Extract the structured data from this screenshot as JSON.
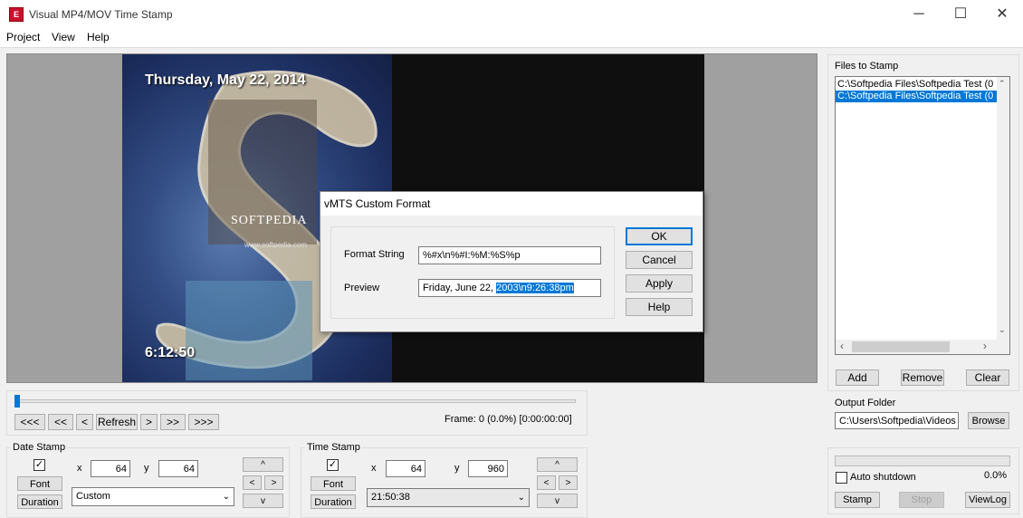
{
  "window": {
    "title": "Visual MP4/MOV Time Stamp",
    "icon": "app-logo-icon",
    "minimize": "─",
    "maximize": "☐",
    "close": "✕"
  },
  "menu": [
    "Project",
    "View",
    "Help"
  ],
  "video": {
    "date_overlay": "Thursday, May 22, 2014",
    "time_overlay": "6:12:50",
    "watermark": "SOFTPEDIA",
    "watermark_url": "www.softpedia.com"
  },
  "dialog": {
    "title": "vMTS Custom Format",
    "format_label": "Format String",
    "format_value": "%#x\\n%#I:%M:%S%p",
    "preview_label": "Preview",
    "preview_plain": "Friday, June 22, ",
    "preview_selected": "2003\\n9:26:38pm",
    "buttons": {
      "ok": "OK",
      "cancel": "Cancel",
      "apply": "Apply",
      "help": "Help"
    }
  },
  "files": {
    "label": "Files to Stamp",
    "items": [
      "C:\\Softpedia Files\\Softpedia Test (0",
      "C:\\Softpedia Files\\Softpedia Test (0"
    ],
    "selected_index": 1,
    "add": "Add",
    "remove": "Remove",
    "clear": "Clear"
  },
  "output": {
    "label": "Output Folder",
    "value": "C:\\Users\\Softpedia\\Videos",
    "browse": "Browse"
  },
  "playback": {
    "position": 0.0,
    "nav": [
      "<<<",
      "<<",
      "<",
      "Refresh",
      ">",
      ">>",
      ">>>"
    ],
    "frame_text": "Frame: 0 (0.0%) [0:00:00:00]"
  },
  "date_stamp": {
    "label": "Date Stamp",
    "checked": true,
    "font": "Font",
    "duration": "Duration",
    "x_label": "x",
    "x": "64",
    "y_label": "y",
    "y": "64",
    "format": "Custom"
  },
  "time_stamp": {
    "label": "Time Stamp",
    "checked": true,
    "font": "Font",
    "duration": "Duration",
    "x_label": "x",
    "x": "64",
    "y_label": "y",
    "y": "960",
    "format": "21:50:38"
  },
  "arrows": {
    "up": "^",
    "left": "<",
    "right": ">",
    "down": "v"
  },
  "progress": {
    "value": 0.0,
    "percent": "0.0%",
    "auto_shutdown": "Auto shutdown",
    "auto_shutdown_checked": false,
    "stamp": "Stamp",
    "stop": "Stop",
    "viewlog": "ViewLog"
  },
  "colors": {
    "selection": "#0078d7",
    "accent_border": "#0078d7",
    "app_icon": "#c8102e"
  }
}
